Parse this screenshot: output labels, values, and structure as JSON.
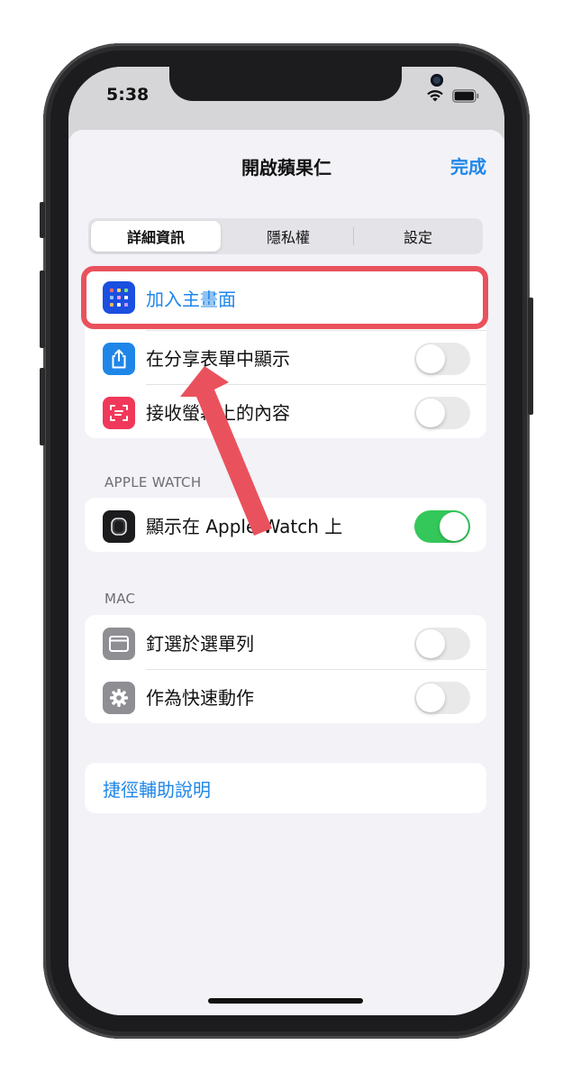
{
  "status_bar": {
    "time": "5:38"
  },
  "nav": {
    "title": "開啟蘋果仁",
    "done_label": "完成"
  },
  "tabs": [
    {
      "label": "詳細資訊",
      "active": true
    },
    {
      "label": "隱私權",
      "active": false
    },
    {
      "label": "設定",
      "active": false
    }
  ],
  "main_group": {
    "items": [
      {
        "label": "加入主畫面",
        "icon": "home-screen-grid-icon",
        "icon_color": "#1a4fe0",
        "highlighted": true
      },
      {
        "label": "在分享表單中顯示",
        "icon": "share-icon",
        "icon_color": "#1f86e8",
        "toggle": false
      },
      {
        "label": "接收螢幕上的內容",
        "icon": "screen-scan-icon",
        "icon_color": "#f0385a",
        "toggle": false
      }
    ]
  },
  "apple_watch_section": {
    "header": "APPLE WATCH",
    "items": [
      {
        "label": "顯示在 Apple Watch 上",
        "icon": "apple-watch-icon",
        "icon_color": "#1c1c1e",
        "toggle": true
      }
    ]
  },
  "mac_section": {
    "header": "MAC",
    "items": [
      {
        "label": "釘選於選單列",
        "icon": "menu-bar-icon",
        "icon_color": "#8e8e93",
        "toggle": false
      },
      {
        "label": "作為快速動作",
        "icon": "gear-icon",
        "icon_color": "#8e8e93",
        "toggle": false
      }
    ]
  },
  "help": {
    "label": "捷徑輔助說明"
  },
  "annotation": {
    "highlight_color": "#e9525d"
  }
}
